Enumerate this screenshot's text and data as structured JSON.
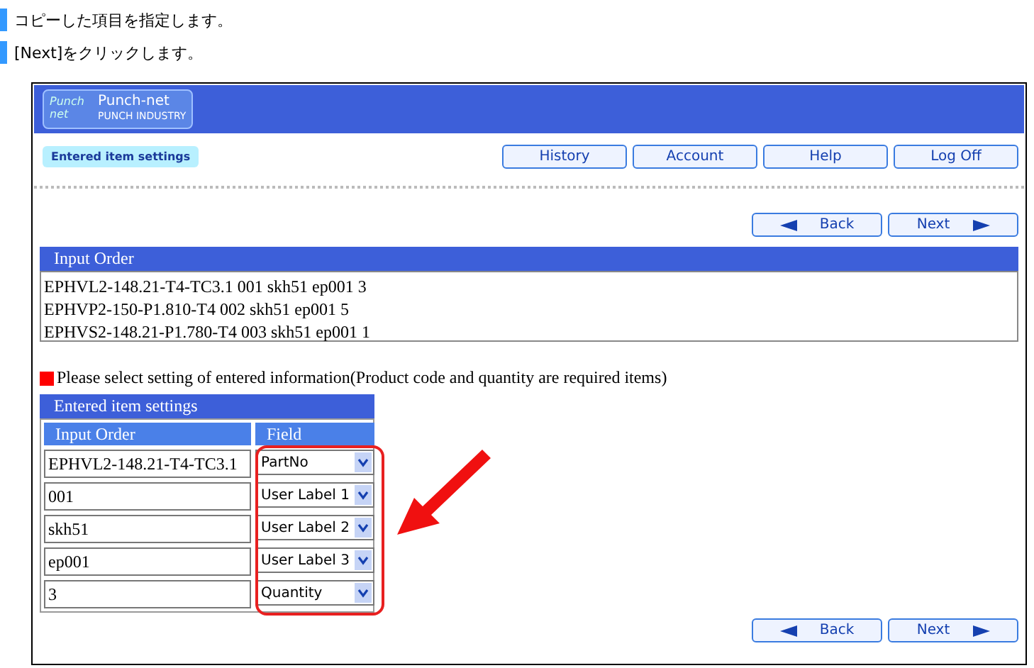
{
  "instructions": [
    "コピーした項目を指定します。",
    "[Next]をクリックします。"
  ],
  "header": {
    "logo_title": "Punch-net",
    "logo_subtitle": "PUNCH INDUSTRY",
    "logo_mark": "Punch net"
  },
  "page_label": "Entered item settings",
  "nav_buttons": [
    "History",
    "Account",
    "Help",
    "Log Off"
  ],
  "top_actions": {
    "back": "Back",
    "next": "Next"
  },
  "input_order": {
    "title": "Input Order",
    "lines": [
      "EPHVL2-148.21-T4-TC3.1 001 skh51 ep001 3",
      "EPHVP2-150-P1.810-T4 002 skh51 ep001 5",
      "EPHVS2-148.21-P1.780-T4 003 skh51 ep001 1"
    ]
  },
  "notice": "Please select setting of entered information(Product code and quantity are required items)",
  "settings": {
    "title": "Entered item settings",
    "columns": [
      "Input Order",
      "Field"
    ],
    "rows": [
      {
        "input": "EPHVL2-148.21-T4-TC3.1",
        "field": "PartNo"
      },
      {
        "input": "001",
        "field": "User Label 1"
      },
      {
        "input": "skh51",
        "field": "User Label 2"
      },
      {
        "input": "ep001",
        "field": "User Label 3"
      },
      {
        "input": "3",
        "field": "Quantity"
      }
    ]
  },
  "bottom_actions": {
    "back": "Back",
    "next": "Next"
  }
}
